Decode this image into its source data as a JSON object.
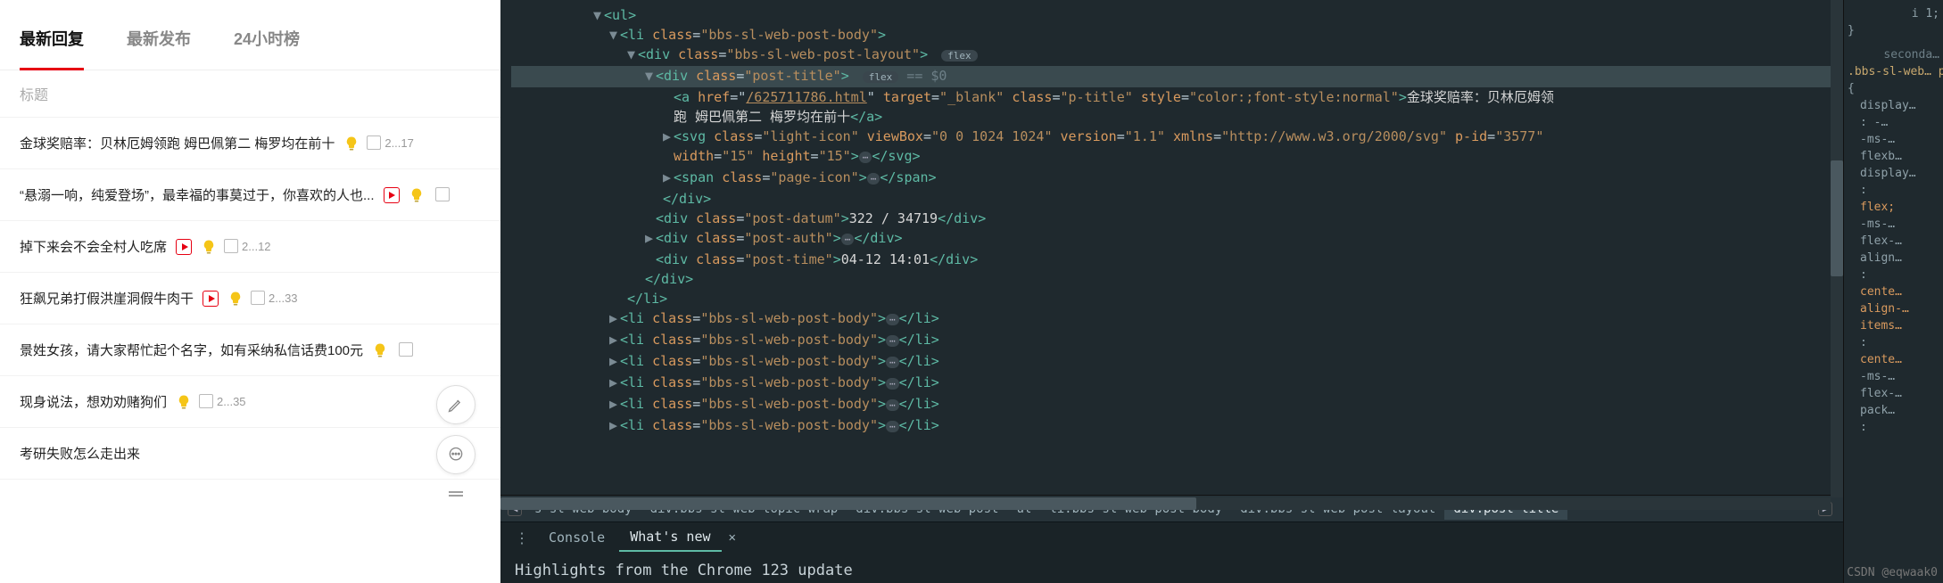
{
  "left": {
    "tabs": [
      "最新回复",
      "最新发布",
      "24小时榜"
    ],
    "active_tab": 0,
    "search_placeholder": "标题",
    "posts": [
      {
        "title": "金球奖赔率：贝林厄姆领跑 姆巴佩第二 梅罗均在前十",
        "bulb": true,
        "play": false,
        "stack": "[回  2...17]"
      },
      {
        "title": "“悬溺一响，纯爱登场”，最幸福的事莫过于，你喜欢的人也...",
        "bulb": true,
        "play": true,
        "stack": ""
      },
      {
        "title": "掉下来会不会全村人吃席",
        "bulb": true,
        "play": true,
        "stack": "[回  2...12]"
      },
      {
        "title": "狂飙兄弟打假洪崖洞假牛肉干",
        "bulb": true,
        "play": true,
        "stack": "[回  2...33]"
      },
      {
        "title": "景姓女孩，请大家帮忙起个名字，如有采纳私信话费100元",
        "bulb": true,
        "play": false,
        "stack": ""
      },
      {
        "title": "现身说法，想劝劝赌狗们",
        "bulb": true,
        "play": false,
        "stack": "[回  2...35]"
      },
      {
        "title": "考研失败怎么走出来",
        "bulb": false,
        "play": false,
        "stack": ""
      }
    ]
  },
  "dom": {
    "ul_open": "<ul>",
    "li_open": "<li class=\"bbs-sl-web-post-body\">",
    "layout_open": "<div class=\"bbs-sl-web-post-layout\">",
    "flex_pill": "flex",
    "title_open": "<div class=\"post-title\">",
    "title_suffix": " == $0",
    "a_href": "/625711786.html",
    "a_target": "_blank",
    "a_class": "p-title",
    "a_style": "color:;font-style:normal",
    "a_text1": "金球奖赔率：贝林厄姆领",
    "a_text2": "跑 姆巴佩第二 梅罗均在前十",
    "a_close": "</a>",
    "svg_class": "light-icon",
    "svg_viewbox": "0 0 1024 1024",
    "svg_version": "1.1",
    "svg_xmlns": "http://www.w3.org/2000/svg",
    "svg_pid": "3577",
    "svg_w": "15",
    "svg_h": "15",
    "svg_close": "</svg>",
    "span_open": "<span class=\"page-icon\">",
    "span_close": "</span>",
    "div_close": "</div>",
    "datum_open": "<div class=\"post-datum\">",
    "datum_text": "322 / 34719",
    "auth_open": "<div class=\"post-auth\">",
    "time_open": "<div class=\"post-time\">",
    "time_text": "04-12 14:01",
    "li_close": "</li>",
    "li_collapsed": "<li class=\"bbs-sl-web-post-body\">"
  },
  "breadcrumb": [
    "s-sl-web-body",
    "div.bbs-sl-web-topic-wrap",
    "div.bbs-sl-web-post",
    "ul",
    "li.bbs-sl-web-post-body",
    "div.bbs-sl-web-post-layout",
    "div.post-title"
  ],
  "breadcrumb_selected": 6,
  "drawer": {
    "tabs": [
      "Console",
      "What's new"
    ],
    "active": 1,
    "headline": "Highlights from the Chrome 123 update"
  },
  "styles": {
    "line0": "i 1;",
    "line1": "}",
    "line2": "seconda…",
    "sel": ".bbs-sl-web… post-body .post-title",
    "brace": "{",
    "props": [
      "display…",
      ": -…",
      "-ms-…",
      "flexb…",
      "display…",
      ":",
      "flex;",
      "-ms-…",
      "flex-…",
      "align…",
      ":",
      "cente…",
      "align-…",
      "items…",
      ":",
      "cente…",
      "-ms-…",
      "flex-…",
      "pack…",
      ":"
    ]
  },
  "watermark": "CSDN @eqwaak0"
}
